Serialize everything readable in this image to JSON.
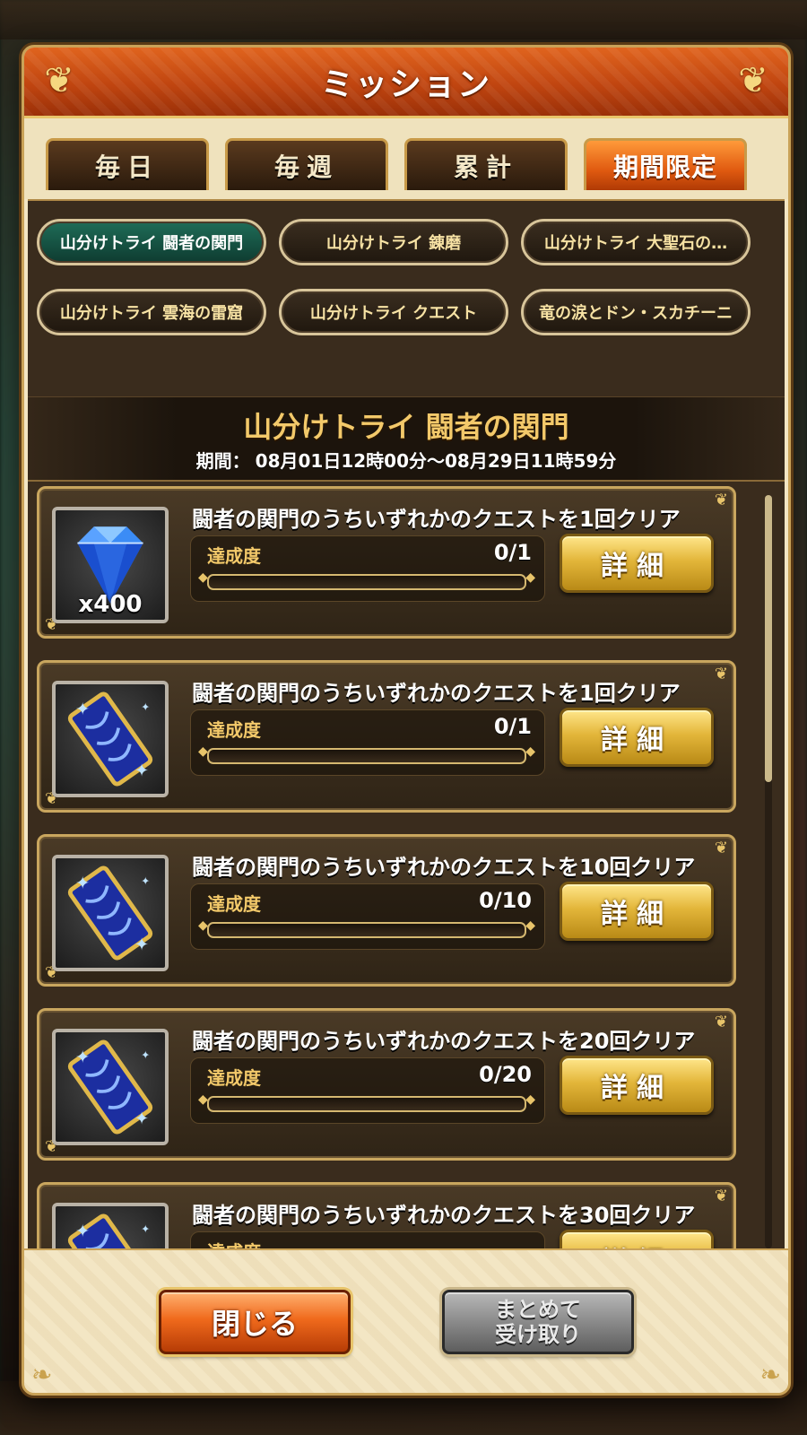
{
  "dialog": {
    "title": "ミッション",
    "tabs": [
      {
        "label": "毎日",
        "active": false
      },
      {
        "label": "毎週",
        "active": false
      },
      {
        "label": "累計",
        "active": false
      },
      {
        "label": "期間限定",
        "active": true
      }
    ]
  },
  "events": [
    {
      "label": "山分けトライ 闘者の関門",
      "active": true
    },
    {
      "label": "山分けトライ 錬磨",
      "active": false
    },
    {
      "label": "山分けトライ 大聖石の…",
      "active": false
    },
    {
      "label": "山分けトライ 雲海の雷窟",
      "active": false
    },
    {
      "label": "山分けトライ クエスト",
      "active": false
    },
    {
      "label": "竜の涙とドン・スカチーニ",
      "active": false
    }
  ],
  "selected_event": {
    "title": "山分けトライ 闘者の関門",
    "period_label": "期間：",
    "period": "08月01日12時00分～08月29日11時59分"
  },
  "missions": [
    {
      "title": "闘者の関門のうちいずれかのクエストを1回クリア",
      "progress_label": "達成度",
      "progress_text": "0/1",
      "progress": 0,
      "reward_icon": "diamond-icon",
      "reward_count": "x400",
      "button": "詳細"
    },
    {
      "title": "闘者の関門のうちいずれかのクエストを1回クリア",
      "progress_label": "達成度",
      "progress_text": "0/1",
      "progress": 0,
      "reward_icon": "ticket-icon",
      "reward_count": "",
      "button": "詳細"
    },
    {
      "title": "闘者の関門のうちいずれかのクエストを10回クリア",
      "progress_label": "達成度",
      "progress_text": "0/10",
      "progress": 0,
      "reward_icon": "ticket-icon",
      "reward_count": "",
      "button": "詳細"
    },
    {
      "title": "闘者の関門のうちいずれかのクエストを20回クリア",
      "progress_label": "達成度",
      "progress_text": "0/20",
      "progress": 0,
      "reward_icon": "ticket-icon",
      "reward_count": "",
      "button": "詳細"
    },
    {
      "title": "闘者の関門のうちいずれかのクエストを30回クリア",
      "progress_label": "達成度",
      "progress_text": "",
      "progress": 0,
      "reward_icon": "ticket-icon",
      "reward_count": "",
      "button": "詳細"
    }
  ],
  "footer": {
    "close_label": "閉じる",
    "claim_all_label_line1": "まとめて",
    "claim_all_label_line2": "受け取り"
  },
  "colors": {
    "accent_orange": "#e0641e",
    "gold": "#e3b63a",
    "active_event": "#1f6d58"
  }
}
